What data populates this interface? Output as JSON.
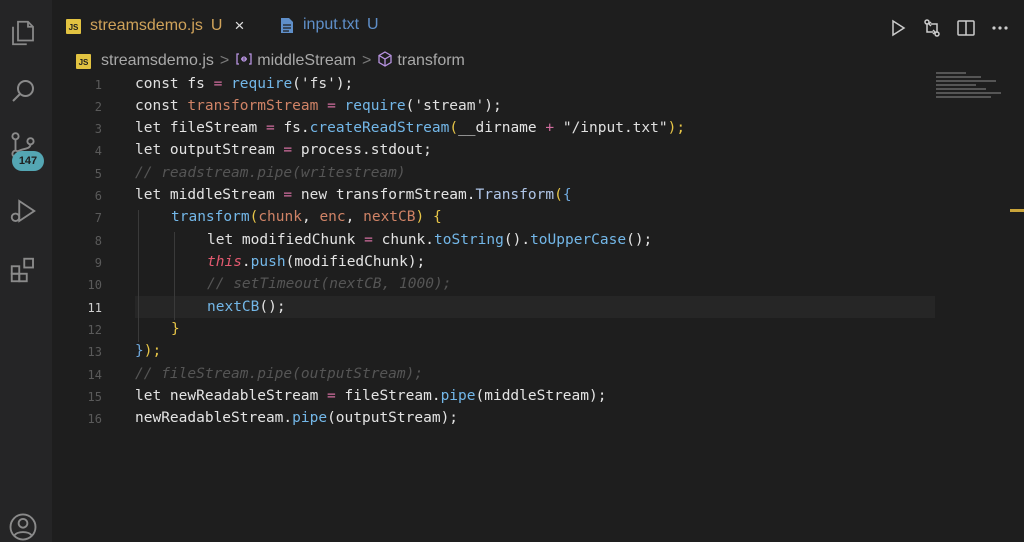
{
  "activity_bar": {
    "icons": [
      "explorer-icon",
      "search-icon",
      "source-control-icon",
      "run-debug-icon",
      "extensions-icon",
      "account-icon"
    ],
    "source_control_badge": "147"
  },
  "tabs": [
    {
      "label": "streamsdemo.js",
      "modified": "U",
      "type": "js",
      "close": "×"
    },
    {
      "label": "input.txt",
      "modified": "U",
      "type": "text"
    }
  ],
  "breadcrumb": {
    "file": "streamsdemo.js",
    "symbol_1": "middleStream",
    "symbol_2": "transform",
    "separator": ">"
  },
  "editor": {
    "active_line": 11,
    "lines": [
      {
        "n": "1"
      },
      {
        "n": "2"
      },
      {
        "n": "3"
      },
      {
        "n": "4"
      },
      {
        "n": "5"
      },
      {
        "n": "6"
      },
      {
        "n": "7"
      },
      {
        "n": "8"
      },
      {
        "n": "9"
      },
      {
        "n": "10"
      },
      {
        "n": "11"
      },
      {
        "n": "12"
      },
      {
        "n": "13"
      },
      {
        "n": "14"
      },
      {
        "n": "15"
      },
      {
        "n": "16"
      }
    ],
    "code": {
      "l1": [
        "const ",
        "fs",
        " = ",
        "require",
        "(",
        "'fs'",
        ");"
      ],
      "l2": [
        "const ",
        "transformStream",
        " = ",
        "require",
        "(",
        "'stream'",
        ");"
      ],
      "l3": [
        "let ",
        "fileStream",
        " = ",
        "fs",
        ".",
        "createReadStream",
        "(",
        "__dirname",
        " + ",
        "\"/input.txt\"",
        ");"
      ],
      "l4": [
        "let ",
        "outputStream",
        " = ",
        "process",
        ".",
        "stdout",
        ";"
      ],
      "l5": "// readstream.pipe(writestream)",
      "l6": [
        "let ",
        "middleStream",
        " = ",
        "new ",
        "transformStream",
        ".",
        "Transform",
        "(",
        "{"
      ],
      "l7": [
        "transform",
        "(",
        "chunk",
        ", ",
        "enc",
        ", ",
        "nextCB",
        ") ",
        "{"
      ],
      "l8": [
        "let ",
        "modifiedChunk",
        " = ",
        "chunk",
        ".",
        "toString",
        "().",
        "toUpperCase",
        "();"
      ],
      "l9": [
        "this",
        ".",
        "push",
        "(",
        "modifiedChunk",
        ");"
      ],
      "l10": "// setTimeout(nextCB, 1000);",
      "l11": [
        "nextCB",
        "();"
      ],
      "l12": "}",
      "l13": [
        "}",
        ");"
      ],
      "l14": "// fileStream.pipe(outputStream);",
      "l15": [
        "let ",
        "newReadableStream",
        " = ",
        "fileStream",
        ".",
        "pipe",
        "(",
        "middleStream",
        ");"
      ],
      "l16": [
        "newReadableStream",
        ".",
        "pipe",
        "(",
        "outputStream",
        ");"
      ]
    }
  },
  "title_actions": [
    "run-icon",
    "compare-changes-icon",
    "split-editor-icon",
    "more-actions-icon"
  ],
  "colors": {
    "accent_js": "#e2c341",
    "tab_modified": "#d0a35a",
    "badge": "#54a6b3"
  }
}
